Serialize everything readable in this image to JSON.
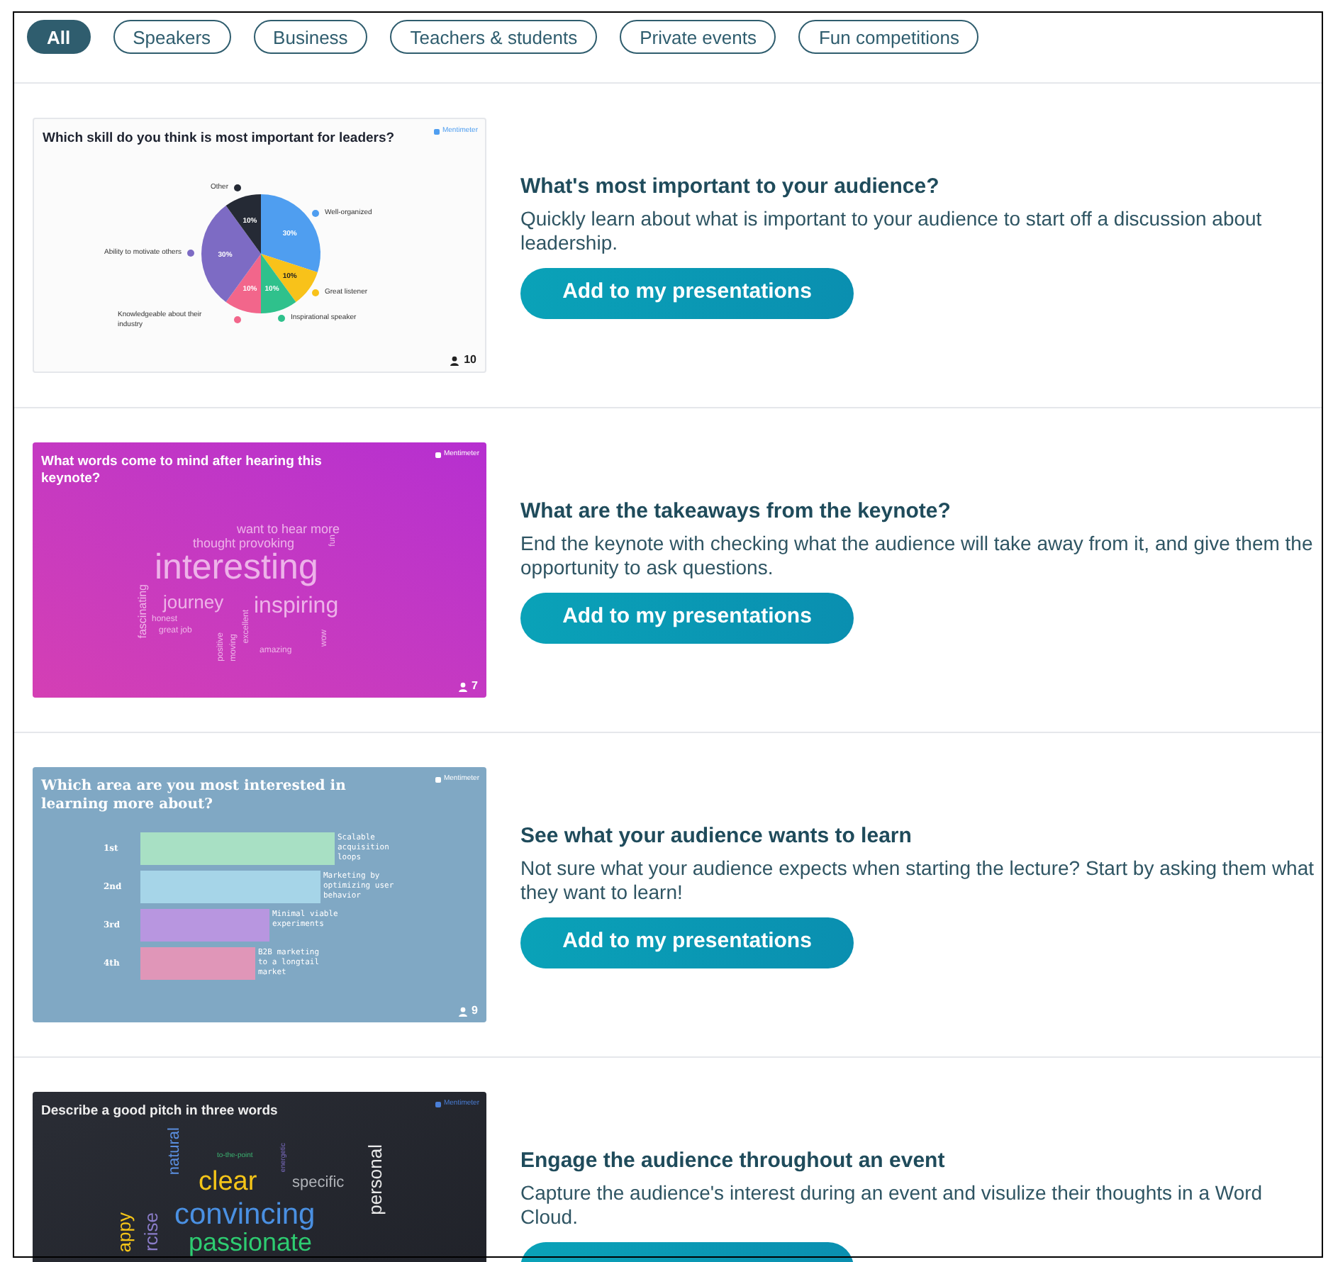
{
  "filters": [
    {
      "label": "All",
      "selected": true
    },
    {
      "label": "Speakers",
      "selected": false
    },
    {
      "label": "Business",
      "selected": false
    },
    {
      "label": "Teachers & students",
      "selected": false
    },
    {
      "label": "Private events",
      "selected": false
    },
    {
      "label": "Fun competitions",
      "selected": false
    }
  ],
  "templates": [
    {
      "title": "What's most important to your audience?",
      "description": "Quickly learn about what is important to your audience to start off a discussion about leadership.",
      "button": "Add to my presentations",
      "slide": {
        "kind": "pie",
        "question": "Which skill do you think is most important for leaders?",
        "brand": "Mentimeter",
        "responses": "10",
        "chart_data": {
          "type": "pie",
          "categories": [
            "Well-organized",
            "Great listener",
            "Inspirational speaker",
            "Knowledgeable about their industry",
            "Ability to motivate others",
            "Other"
          ],
          "values": [
            30,
            10,
            10,
            10,
            30,
            10
          ],
          "value_labels": [
            "30%",
            "10%",
            "10%",
            "10%",
            "30%",
            "10%"
          ]
        }
      }
    },
    {
      "title": "What are the takeaways from the keynote?",
      "description": "End the keynote with checking what the audience will take away from it, and give them the opportunity to ask questions.",
      "button": "Add to my presentations",
      "slide": {
        "kind": "cloud",
        "question": "What words come to mind after hearing this keynote?",
        "brand": "Mentimeter",
        "responses": "7",
        "words": [
          "want to hear more",
          "thought provoking",
          "fun",
          "interesting",
          "journey",
          "inspiring",
          "fascinating",
          "honest",
          "great job",
          "positive",
          "moving",
          "excellent",
          "amazing",
          "wow"
        ]
      }
    },
    {
      "title": "See what your audience wants to learn",
      "description": "Not sure what your audience expects when starting the lecture? Start by asking them what they want to learn!",
      "button": "Add to my presentations",
      "slide": {
        "kind": "ranking",
        "question": "Which area are you most interested in learning more about?",
        "brand": "Mentimeter",
        "responses": "9",
        "items": [
          {
            "rank": "1st",
            "label": "Scalable acquisition loops"
          },
          {
            "rank": "2nd",
            "label": "Marketing by optimizing user behavior"
          },
          {
            "rank": "3rd",
            "label": "Minimal viable experiments"
          },
          {
            "rank": "4th",
            "label": "B2B marketing to a longtail market"
          }
        ]
      }
    },
    {
      "title": "Engage the audience throughout an event",
      "description": "Capture the audience's interest during an event and visulize their thoughts in a Word Cloud.",
      "slide": {
        "kind": "cloud",
        "question": "Describe a good pitch in three words",
        "brand": "Mentimeter",
        "words": [
          "natural",
          "to-the-point",
          "energetic",
          "clear",
          "specific",
          "personal",
          "convincing",
          "appy",
          "rcise",
          "passionate"
        ]
      }
    }
  ]
}
